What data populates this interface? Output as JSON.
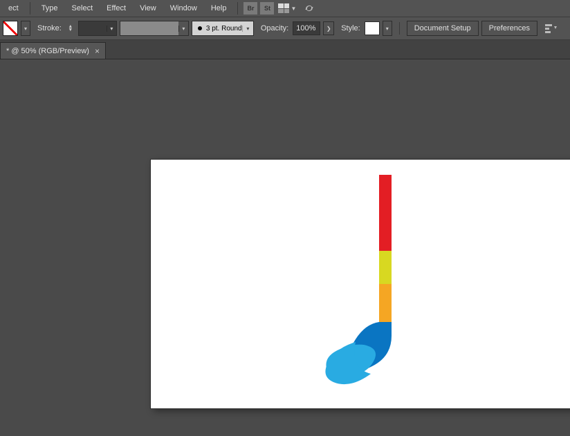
{
  "menu": {
    "items": [
      "ect",
      "Type",
      "Select",
      "Effect",
      "View",
      "Window",
      "Help"
    ]
  },
  "iconButtons": {
    "br": "Br",
    "st": "St"
  },
  "options": {
    "strokeLabel": "Stroke:",
    "brushLabel": "3 pt. Round",
    "opacityLabel": "Opacity:",
    "opacityValue": "100%",
    "styleLabel": "Style:",
    "docSetup": "Document Setup",
    "preferences": "Preferences"
  },
  "tab": {
    "title": "* @ 50% (RGB/Preview)"
  },
  "artwork": {
    "colors": {
      "red": "#e31e24",
      "yellow": "#d8d821",
      "orange": "#f5a623",
      "darkblue": "#0a75c2",
      "lightblue": "#29abe2"
    }
  }
}
